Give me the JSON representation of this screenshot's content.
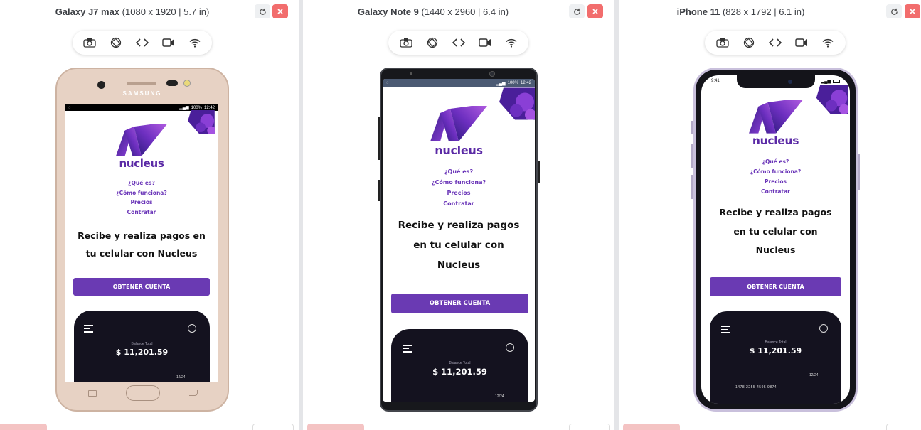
{
  "devices": [
    {
      "name": "Galaxy J7 max",
      "specs": "(1080 x 1920 | 5.7 in)",
      "frame_brand": "SAMSUNG",
      "status_time": "12:42",
      "status_battery": "100%"
    },
    {
      "name": "Galaxy Note 9",
      "specs": "(1440 x 2960 | 6.4 in)",
      "status_time": "12:42",
      "status_battery": "100%"
    },
    {
      "name": "iPhone 11",
      "specs": "(828 x 1792 | 6.1 in)",
      "status_time": "9:41"
    }
  ],
  "toolbar_icons": [
    "camera-icon",
    "rotate-icon",
    "code-icon",
    "video-icon",
    "wifi-icon"
  ],
  "site": {
    "brand": "nucleus",
    "nav": [
      "¿Qué es?",
      "¿Cómo funciona?",
      "Precios",
      "Contratar"
    ],
    "headline_lines_j7": [
      "Recibe y realiza pagos en",
      "tu celular con Nucleus"
    ],
    "headline_lines_note": [
      "Recibe y realiza pagos",
      "en tu celular con",
      "Nucleus"
    ],
    "headline_lines_iphone": [
      "Recibe y realiza pagos",
      "en tu celular con",
      "Nucleus"
    ],
    "cta": "OBTENER CUENTA",
    "card": {
      "balance_label": "Balance Total",
      "balance": "$ 11,201.59",
      "expiry": "12/24",
      "number": "1478 2255 4595 9874"
    }
  },
  "colors": {
    "brand_purple": "#5b2aa6",
    "cta_purple": "#6a3ab3",
    "card_dark": "#14121f",
    "close_red": "#f26d6d"
  }
}
